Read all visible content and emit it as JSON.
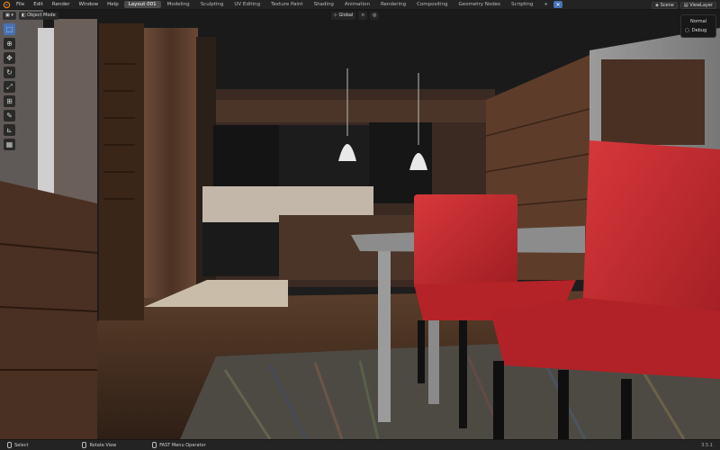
{
  "menu": [
    "File",
    "Edit",
    "Render",
    "Window",
    "Help"
  ],
  "workspaces": [
    {
      "label": "Layout 001",
      "active": true
    },
    {
      "label": "Modeling",
      "active": false
    },
    {
      "label": "Sculpting",
      "active": false
    },
    {
      "label": "UV Editing",
      "active": false
    },
    {
      "label": "Texture Paint",
      "active": false
    },
    {
      "label": "Shading",
      "active": false
    },
    {
      "label": "Animation",
      "active": false
    },
    {
      "label": "Rendering",
      "active": false
    },
    {
      "label": "Compositing",
      "active": false
    },
    {
      "label": "Geometry Nodes",
      "active": false
    },
    {
      "label": "Scripting",
      "active": false
    }
  ],
  "scene": {
    "label": "Scene"
  },
  "view_layer": {
    "label": "ViewLayer"
  },
  "header": {
    "mode": "Object Mode",
    "orientation": "Global"
  },
  "dropdown": {
    "items": [
      "Normal",
      "Debug"
    ]
  },
  "status": {
    "select": "Select",
    "rotate": "Rotate View",
    "operator": "FAST Menu Operator",
    "version": "3.5.1"
  },
  "colors": {
    "accent": "#4772b3",
    "chair": "#c0262a",
    "wood": "#5a3b2a"
  }
}
